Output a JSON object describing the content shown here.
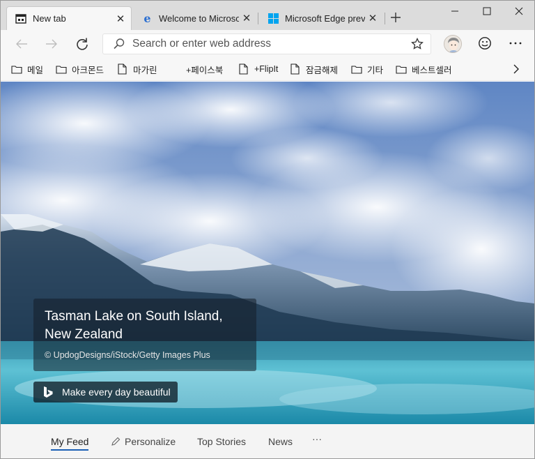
{
  "tabs": [
    {
      "title": "New tab",
      "icon": "new-tab-page-icon",
      "active": true
    },
    {
      "title": "Welcome to Microsoft",
      "icon": "edge-legacy-icon",
      "active": false
    },
    {
      "title": "Microsoft Edge previe",
      "icon": "windows-logo-icon",
      "active": false
    }
  ],
  "toolbar": {
    "search_placeholder": "Search or enter web address"
  },
  "favorites": [
    {
      "label": "메일",
      "icon": "folder-icon"
    },
    {
      "label": "아크몬드",
      "icon": "folder-icon"
    },
    {
      "label": "마가린",
      "icon": "page-icon"
    },
    {
      "label": "+페이스북",
      "icon": "none"
    },
    {
      "label": "+FlipIt",
      "icon": "page-icon"
    },
    {
      "label": "잠금해제",
      "icon": "page-icon"
    },
    {
      "label": "기타",
      "icon": "folder-icon"
    },
    {
      "label": "베스트셀러",
      "icon": "folder-icon"
    }
  ],
  "hero": {
    "title": "Tasman Lake on South Island, New Zealand",
    "credit": "© UpdogDesigns/iStock/Getty Images Plus",
    "bing_button": "Make every day beautiful"
  },
  "feed": {
    "items": [
      "My Feed",
      "Personalize",
      "Top Stories",
      "News"
    ],
    "more": "···"
  },
  "colors": {
    "accent": "#1a5fb4",
    "edge_blue": "#2c6fd1",
    "windows_blue": "#00a4ef"
  }
}
